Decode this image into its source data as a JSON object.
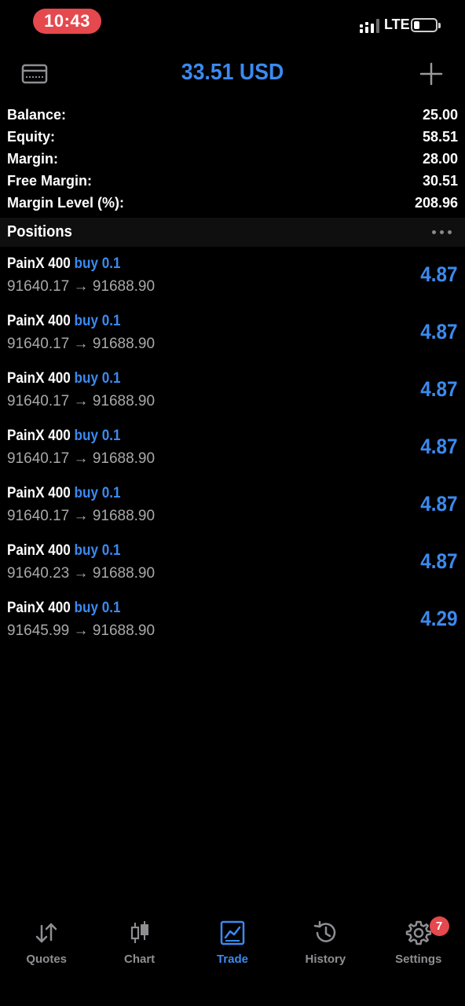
{
  "status_bar": {
    "time": "10:43",
    "network": "LTE",
    "colors": {
      "time_pill": "#e5484d"
    }
  },
  "header": {
    "title": "33.51 USD",
    "left_icon": "wallet-icon",
    "right_icon": "plus-icon",
    "colors": {
      "accent": "#3b8af0"
    }
  },
  "summary": [
    {
      "label": "Balance:",
      "value": "25.00"
    },
    {
      "label": "Equity:",
      "value": "58.51"
    },
    {
      "label": "Margin:",
      "value": "28.00"
    },
    {
      "label": "Free Margin:",
      "value": "30.51"
    },
    {
      "label": "Margin Level (%):",
      "value": "208.96"
    }
  ],
  "positions": {
    "title": "Positions",
    "more_icon": "more-dots-icon",
    "items": [
      {
        "symbol": "PainX 400",
        "side": "buy 0.1",
        "open": "91640.17",
        "arrow": "→",
        "current": "91688.90",
        "profit": "4.87"
      },
      {
        "symbol": "PainX 400",
        "side": "buy 0.1",
        "open": "91640.17",
        "arrow": "→",
        "current": "91688.90",
        "profit": "4.87"
      },
      {
        "symbol": "PainX 400",
        "side": "buy 0.1",
        "open": "91640.17",
        "arrow": "→",
        "current": "91688.90",
        "profit": "4.87"
      },
      {
        "symbol": "PainX 400",
        "side": "buy 0.1",
        "open": "91640.17",
        "arrow": "→",
        "current": "91688.90",
        "profit": "4.87"
      },
      {
        "symbol": "PainX 400",
        "side": "buy 0.1",
        "open": "91640.17",
        "arrow": "→",
        "current": "91688.90",
        "profit": "4.87"
      },
      {
        "symbol": "PainX 400",
        "side": "buy 0.1",
        "open": "91640.23",
        "arrow": "→",
        "current": "91688.90",
        "profit": "4.87"
      },
      {
        "symbol": "PainX 400",
        "side": "buy 0.1",
        "open": "91645.99",
        "arrow": "→",
        "current": "91688.90",
        "profit": "4.29"
      }
    ]
  },
  "tabs": [
    {
      "label": "Quotes",
      "icon": "quotes-arrows-icon",
      "active": false
    },
    {
      "label": "Chart",
      "icon": "candlestick-chart-icon",
      "active": false
    },
    {
      "label": "Trade",
      "icon": "trade-chart-icon",
      "active": true
    },
    {
      "label": "History",
      "icon": "history-clock-icon",
      "active": false
    },
    {
      "label": "Settings",
      "icon": "gear-icon",
      "active": false,
      "badge": "7"
    }
  ]
}
